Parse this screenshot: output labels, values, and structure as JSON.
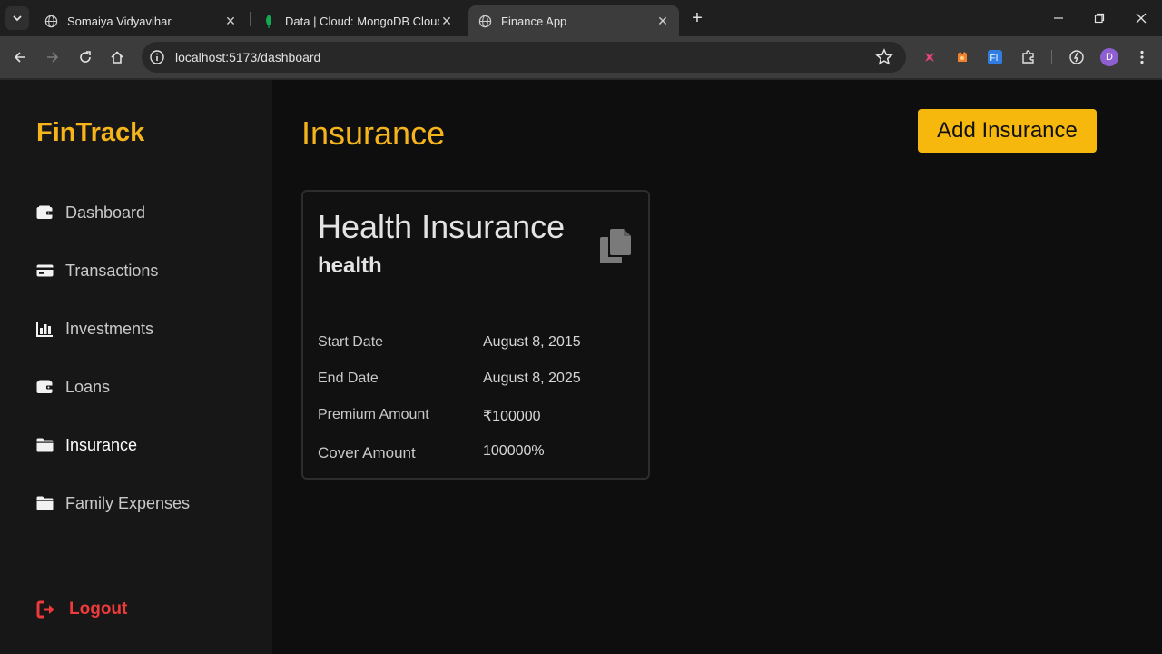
{
  "browser": {
    "tabs": [
      {
        "title": "Somaiya Vidyavihar",
        "active": false
      },
      {
        "title": "Data | Cloud: MongoDB Cloud",
        "active": false
      },
      {
        "title": "Finance App",
        "active": true
      }
    ],
    "url": "localhost:5173/dashboard",
    "profile_initial": "D"
  },
  "sidebar": {
    "brand": "FinTrack",
    "items": [
      {
        "label": "Dashboard",
        "icon": "wallet-icon"
      },
      {
        "label": "Transactions",
        "icon": "credit-card-icon"
      },
      {
        "label": "Investments",
        "icon": "bar-chart-icon"
      },
      {
        "label": "Loans",
        "icon": "wallet-icon"
      },
      {
        "label": "Insurance",
        "icon": "folder-icon",
        "active": true
      },
      {
        "label": "Family Expenses",
        "icon": "folder-icon"
      }
    ],
    "logout": "Logout"
  },
  "main": {
    "title": "Insurance",
    "add_button": "Add Insurance",
    "card": {
      "title": "Health Insurance",
      "type": "health",
      "rows": [
        {
          "label": "Start Date",
          "value": "August 8, 2015"
        },
        {
          "label": "End Date",
          "value": "August 8, 2025"
        },
        {
          "label": "Premium Amount",
          "value": "₹100000"
        },
        {
          "label": "Cover Amount",
          "value": "100000%"
        }
      ]
    }
  },
  "colors": {
    "accent": "#f5b41c",
    "button": "#f7b80e",
    "logout": "#ee3a3a",
    "sidebar_bg": "#171717",
    "main_bg": "#0e0e0e"
  }
}
